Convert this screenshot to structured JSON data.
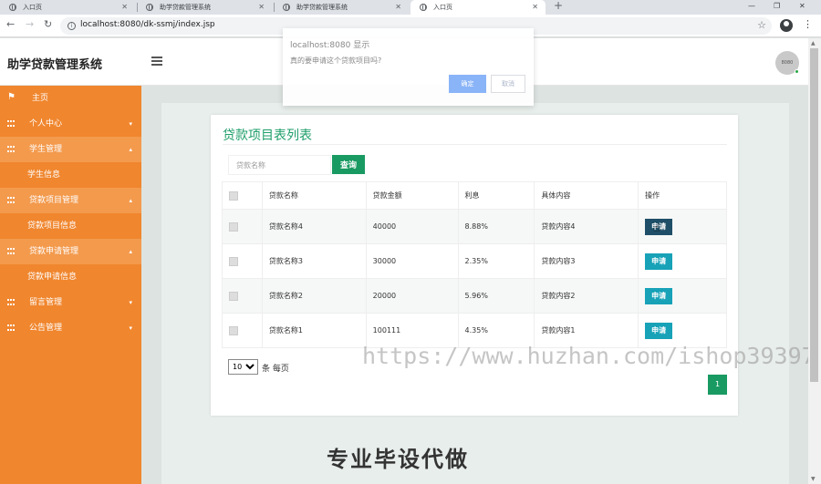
{
  "browser": {
    "tabs": [
      {
        "title": "入口页",
        "active": false
      },
      {
        "title": "助学贷款管理系统",
        "active": false
      },
      {
        "title": "助学贷款管理系统",
        "active": false
      },
      {
        "title": "入口页",
        "active": true
      }
    ],
    "new_tab": "+",
    "url": "localhost:8080/dk-ssmj/index.jsp",
    "window_controls": [
      "—",
      "❐",
      "✕"
    ]
  },
  "header": {
    "app_title": "助学贷款管理系统",
    "avatar_label": "8080"
  },
  "sidebar": {
    "items": [
      {
        "label": "主页",
        "type": "home"
      },
      {
        "label": "个人中心",
        "type": "group",
        "caret": "▾"
      },
      {
        "label": "学生管理",
        "type": "group",
        "caret": "▴"
      },
      {
        "label": "学生信息",
        "type": "sub"
      },
      {
        "label": "贷款项目管理",
        "type": "group",
        "caret": "▴"
      },
      {
        "label": "贷款项目信息",
        "type": "sub"
      },
      {
        "label": "贷款申请管理",
        "type": "group",
        "caret": "▴"
      },
      {
        "label": "贷款申请信息",
        "type": "sub"
      },
      {
        "label": "留言管理",
        "type": "group",
        "caret": "▾"
      },
      {
        "label": "公告管理",
        "type": "group",
        "caret": "▾"
      }
    ]
  },
  "main": {
    "card_title": "贷款项目表列表",
    "search": {
      "placeholder": "贷款名称",
      "button": "查询"
    },
    "table": {
      "headers": [
        "",
        "贷款名称",
        "贷款金额",
        "利息",
        "具体内容",
        "操作"
      ],
      "rows": [
        {
          "name": "贷款名称4",
          "amount": "40000",
          "interest": "8.88%",
          "content": "贷款内容4",
          "action": "申请"
        },
        {
          "name": "贷款名称3",
          "amount": "30000",
          "interest": "2.35%",
          "content": "贷款内容3",
          "action": "申请"
        },
        {
          "name": "贷款名称2",
          "amount": "20000",
          "interest": "5.96%",
          "content": "贷款内容2",
          "action": "申请"
        },
        {
          "name": "贷款名称1",
          "amount": "100111",
          "interest": "4.35%",
          "content": "贷款内容1",
          "action": "申请"
        }
      ]
    },
    "page_size": "10",
    "per_page_label": "条 每页",
    "current_page": "1"
  },
  "dialog": {
    "title": "localhost:8080 显示",
    "message": "真的要申请这个贷款项目吗?",
    "ok": "确定",
    "cancel": "取消"
  },
  "overlay": {
    "watermark": "https://www.huzhan.com/ishop39397",
    "promo": "专业毕设代做"
  }
}
